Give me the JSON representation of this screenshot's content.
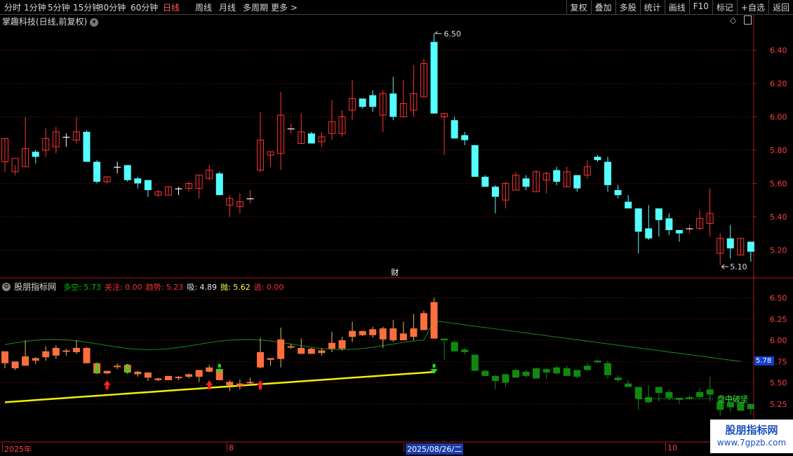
{
  "toolbar": {
    "periods": [
      "分时",
      "1分钟",
      "5分钟",
      "15分钟",
      "30分钟",
      "60分钟",
      "日线",
      "周线",
      "月线",
      "多周期",
      "更多 >"
    ],
    "active_index": 6,
    "right_buttons": [
      "复权",
      "叠加",
      "多股",
      "统计",
      "画线",
      "F10",
      "标记",
      "+自选",
      "返回"
    ]
  },
  "main_chart": {
    "title": "掌趣科技(日线,前复权)",
    "max_label": "6.50",
    "min_label": "5.10",
    "y_ticks": [
      "6.40",
      "6.20",
      "6.00",
      "5.80",
      "5.60",
      "5.40",
      "5.20"
    ],
    "fin_marker": "财"
  },
  "indicator": {
    "name": "股朋指标网",
    "items": [
      {
        "label": "多空:",
        "value": "5.73",
        "color": "#00c000"
      },
      {
        "label": "关注:",
        "value": "0.00",
        "color": "#ff3030"
      },
      {
        "label": "趋势:",
        "value": "5.23",
        "color": "#ff3030"
      },
      {
        "label": "吸:",
        "value": "4.89",
        "color": "#e8e8e8"
      },
      {
        "label": "抛:",
        "value": "5.62",
        "color": "#ffff40"
      },
      {
        "label": "逃:",
        "value": "0.00",
        "color": "#ff3030"
      }
    ],
    "y_ticks": [
      "6.50",
      "6.25",
      "6.00",
      "5.75",
      "5.50",
      "5.25"
    ],
    "current_value": "5.78",
    "annotation": "盘中破坚"
  },
  "date_axis": {
    "labels": [
      "2025年",
      "8",
      "2025/08/26/二",
      "10"
    ]
  },
  "watermark": {
    "line1": "股朋指标网",
    "line2": "www.7gpzb.com"
  },
  "colors": {
    "up": "#ff3333",
    "down": "#54ffff",
    "ind_up": "#ff6f3d",
    "ind_down": "#0f8a0f",
    "trend": "#f0f000",
    "line": "#1a8a1a"
  },
  "chart_data": {
    "type": "candlestick",
    "ylim": [
      5.05,
      6.55
    ],
    "candles": [
      [
        5.73,
        5.87,
        5.67,
        5.87
      ],
      [
        5.67,
        5.75,
        5.65,
        5.71
      ],
      [
        5.7,
        5.81,
        5.7,
        6.0
      ],
      [
        5.79,
        5.76,
        5.72,
        5.8
      ],
      [
        5.8,
        5.87,
        5.76,
        5.93
      ],
      [
        5.82,
        5.91,
        5.78,
        5.94
      ],
      [
        5.88,
        5.87,
        5.82,
        5.9
      ],
      [
        5.86,
        5.91,
        5.84,
        6.0
      ],
      [
        5.91,
        5.73,
        5.73,
        5.92
      ],
      [
        5.73,
        5.61,
        5.6,
        5.74
      ],
      [
        5.61,
        5.64,
        5.6,
        5.64
      ],
      [
        5.7,
        5.69,
        5.66,
        5.73
      ],
      [
        5.71,
        5.62,
        5.61,
        5.71
      ],
      [
        5.63,
        5.6,
        5.57,
        5.64
      ],
      [
        5.62,
        5.56,
        5.52,
        5.62
      ],
      [
        5.53,
        5.55,
        5.52,
        5.56
      ],
      [
        5.53,
        5.58,
        5.53,
        5.58
      ],
      [
        5.57,
        5.56,
        5.53,
        5.58
      ],
      [
        5.57,
        5.6,
        5.55,
        5.61
      ],
      [
        5.57,
        5.65,
        5.51,
        5.65
      ],
      [
        5.63,
        5.68,
        5.62,
        5.71
      ],
      [
        5.66,
        5.53,
        5.53,
        5.67
      ],
      [
        5.47,
        5.51,
        5.4,
        5.53
      ],
      [
        5.46,
        5.49,
        5.42,
        5.54
      ],
      [
        5.5,
        5.51,
        5.48,
        5.56
      ],
      [
        5.68,
        5.86,
        5.67,
        6.03
      ],
      [
        5.77,
        5.79,
        5.7,
        5.79
      ],
      [
        5.78,
        6.01,
        5.68,
        6.15
      ],
      [
        5.92,
        5.93,
        5.9,
        5.96
      ],
      [
        5.84,
        5.91,
        5.84,
        6.02
      ],
      [
        5.9,
        5.84,
        5.84,
        5.91
      ],
      [
        5.85,
        5.88,
        5.82,
        5.91
      ],
      [
        5.9,
        5.97,
        5.86,
        6.1
      ],
      [
        5.9,
        6.0,
        5.88,
        6.04
      ],
      [
        6.04,
        6.11,
        5.98,
        6.22
      ],
      [
        6.11,
        6.06,
        6.05,
        6.11
      ],
      [
        6.13,
        6.06,
        6.03,
        6.16
      ],
      [
        6.01,
        6.14,
        5.91,
        6.16
      ],
      [
        6.14,
        6.0,
        5.98,
        6.24
      ],
      [
        6.0,
        6.08,
        6.0,
        6.22
      ],
      [
        6.04,
        6.14,
        6.0,
        6.31
      ],
      [
        6.12,
        6.32,
        6.12,
        6.35
      ],
      [
        6.45,
        6.02,
        6.02,
        6.5
      ],
      [
        6.0,
        6.02,
        5.77,
        6.02
      ],
      [
        5.98,
        5.87,
        5.87,
        6.0
      ],
      [
        5.89,
        5.86,
        5.83,
        5.91
      ],
      [
        5.83,
        5.64,
        5.64,
        5.83
      ],
      [
        5.64,
        5.58,
        5.58,
        5.65
      ],
      [
        5.58,
        5.52,
        5.42,
        5.59
      ],
      [
        5.5,
        5.6,
        5.45,
        5.61
      ],
      [
        5.56,
        5.65,
        5.56,
        5.67
      ],
      [
        5.63,
        5.58,
        5.56,
        5.65
      ],
      [
        5.55,
        5.67,
        5.55,
        5.68
      ],
      [
        5.62,
        5.66,
        5.54,
        5.67
      ],
      [
        5.68,
        5.61,
        5.59,
        5.7
      ],
      [
        5.58,
        5.67,
        5.58,
        5.7
      ],
      [
        5.65,
        5.57,
        5.55,
        5.65
      ],
      [
        5.65,
        5.7,
        5.63,
        5.74
      ],
      [
        5.76,
        5.74,
        5.73,
        5.77
      ],
      [
        5.73,
        5.59,
        5.55,
        5.76
      ],
      [
        5.56,
        5.53,
        5.51,
        5.59
      ],
      [
        5.49,
        5.45,
        5.46,
        5.53
      ],
      [
        5.45,
        5.31,
        5.18,
        5.45
      ],
      [
        5.33,
        5.27,
        5.26,
        5.47
      ],
      [
        5.45,
        5.38,
        5.28,
        5.4
      ],
      [
        5.39,
        5.32,
        5.29,
        5.42
      ],
      [
        5.32,
        5.3,
        5.25,
        5.32
      ],
      [
        5.32,
        5.33,
        5.3,
        5.35
      ],
      [
        5.33,
        5.39,
        5.32,
        5.44
      ],
      [
        5.36,
        5.42,
        5.28,
        5.57
      ],
      [
        5.18,
        5.27,
        5.11,
        5.3
      ],
      [
        5.27,
        5.21,
        5.15,
        5.35
      ],
      [
        5.17,
        5.27,
        5.17,
        5.27
      ],
      [
        5.25,
        5.19,
        5.13,
        5.25
      ]
    ]
  }
}
